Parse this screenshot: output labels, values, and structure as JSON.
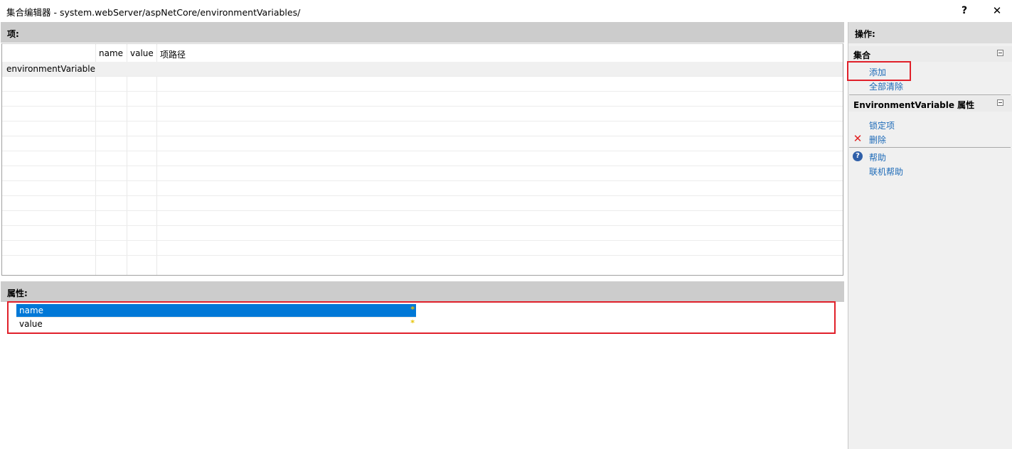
{
  "window": {
    "title": "集合编辑器 - system.webServer/aspNetCore/environmentVariables/",
    "help_label": "?",
    "close_label": "✕"
  },
  "items_section": {
    "header": "项:",
    "columns": [
      "name",
      "value",
      "项路径"
    ],
    "rows": [
      {
        "label": "environmentVariable"
      }
    ]
  },
  "properties_section": {
    "header": "属性:",
    "properties": [
      {
        "name": "name",
        "marker": "*"
      },
      {
        "name": "value",
        "marker": "*"
      }
    ]
  },
  "actions_pane": {
    "title": "操作:",
    "collection_group": {
      "title": "集合",
      "add": "添加",
      "clear_all": "全部清除"
    },
    "item_group": {
      "title": "EnvironmentVariable 属性",
      "lock": "锁定项",
      "delete": "删除",
      "help": "帮助",
      "online_help": "联机帮助"
    }
  },
  "colors": {
    "selection": "#0078d7",
    "link": "#1e6bb8",
    "highlight_box": "#e0202a",
    "required_marker": "#e6c200"
  }
}
